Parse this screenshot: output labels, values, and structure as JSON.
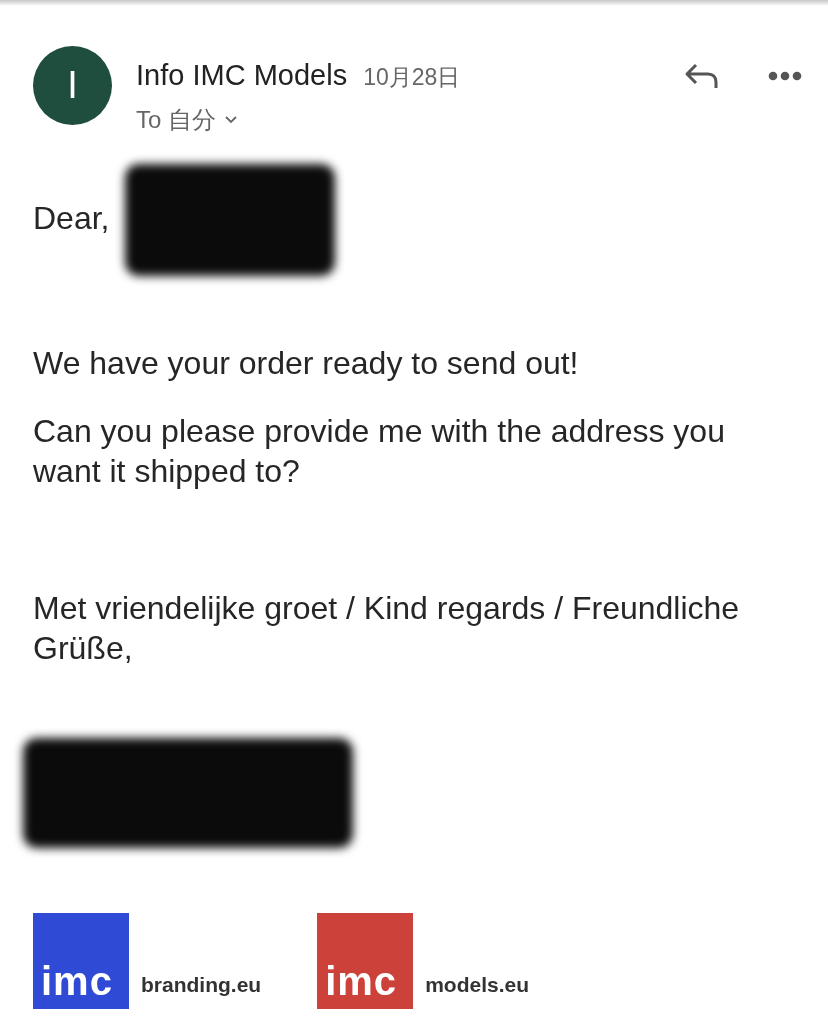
{
  "sender": {
    "avatar_letter": "I",
    "name": "Info IMC Models",
    "date": "10月28日",
    "recipient_label": "To",
    "recipient": "自分"
  },
  "body": {
    "greeting": "Dear,",
    "paragraphs": [
      "We have your order ready to send out!",
      "Can you please provide me with the address you want it shipped to?"
    ],
    "closing": "Met vriendelijke groet / Kind regards / Freundliche Grüße,"
  },
  "logos": [
    {
      "mark": "imc",
      "domain": "branding.eu",
      "color": "#2f4bd6"
    },
    {
      "mark": "imc",
      "domain": "models.eu",
      "color": "#cc423a"
    }
  ]
}
